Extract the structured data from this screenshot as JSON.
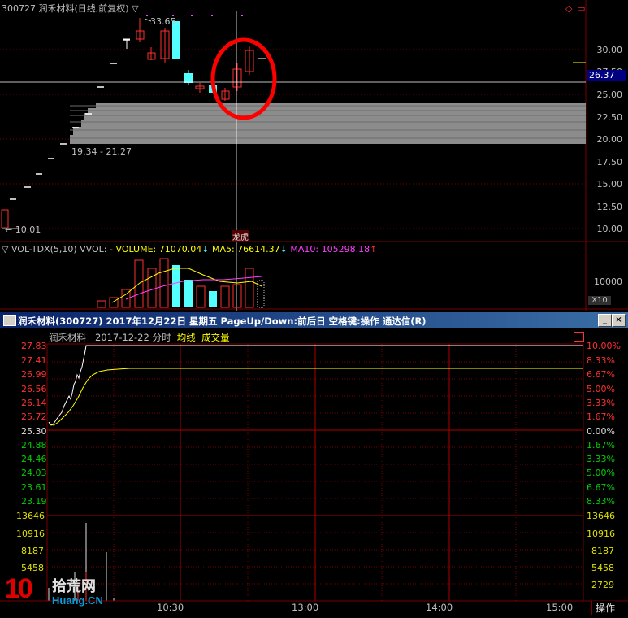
{
  "kline": {
    "code": "300727",
    "name": "润禾材料",
    "period": "(日线,前复权)",
    "filter_icon": "▽",
    "max_label": "33.65",
    "min_label": "10.01",
    "range_label": "19.34 - 21.27",
    "event_tag": "龙虎",
    "current_price": "26.37",
    "price_axis": [
      "30.00",
      "27.50",
      "25.00",
      "22.50",
      "20.00",
      "17.50",
      "15.00",
      "12.50",
      "10.00"
    ],
    "colors": {
      "up": "#ff3030",
      "down": "#54ffff",
      "grid": "#7a0000",
      "chip": "#909090",
      "circle": "#ff0000",
      "crosshair": "#ffffff"
    }
  },
  "volume": {
    "indicator": "VOL-TDX(5,10)",
    "vvol": "VVOL: -",
    "volume_label": "VOLUME: 71070.04",
    "ma5_label": "MA5: 76614.37",
    "ma10_label": "MA10: 105298.18",
    "axis_value": "10000",
    "axis_unit": "X10",
    "colors": {
      "volume": "#ffff00",
      "ma5": "#ffff00",
      "ma10": "#ff40ff"
    }
  },
  "window": {
    "title": "润禾材料(300727) 2017年12月22日 星期五 PageUp/Down:前后日 空格键:操作 通达信(R)",
    "minimize": "_",
    "close": "×"
  },
  "intraday": {
    "stock_name": "润禾材料",
    "datetime": "2017-12-22 分时",
    "avg_line": "均线",
    "volume_label": "成交量",
    "left_prices": [
      "27.83",
      "27.41",
      "26.99",
      "26.56",
      "26.14",
      "25.72",
      "25.30",
      "24.88",
      "24.46",
      "24.03",
      "23.61",
      "23.19"
    ],
    "right_pcts": [
      "10.00%",
      "8.33%",
      "6.67%",
      "5.00%",
      "3.33%",
      "1.67%",
      "0.00%",
      "1.67%",
      "3.33%",
      "5.00%",
      "6.67%",
      "8.33%"
    ],
    "vol_left": [
      "13646",
      "10916",
      "8187",
      "5458"
    ],
    "vol_right": [
      "13646",
      "10916",
      "8187",
      "5458",
      "2729"
    ],
    "times": [
      "10:30",
      "13:00",
      "14:00",
      "15:00"
    ],
    "operate_button": "操作",
    "watermark_num": "10",
    "watermark_cn": "拾荒网",
    "watermark_url": "Huang.CN"
  }
}
